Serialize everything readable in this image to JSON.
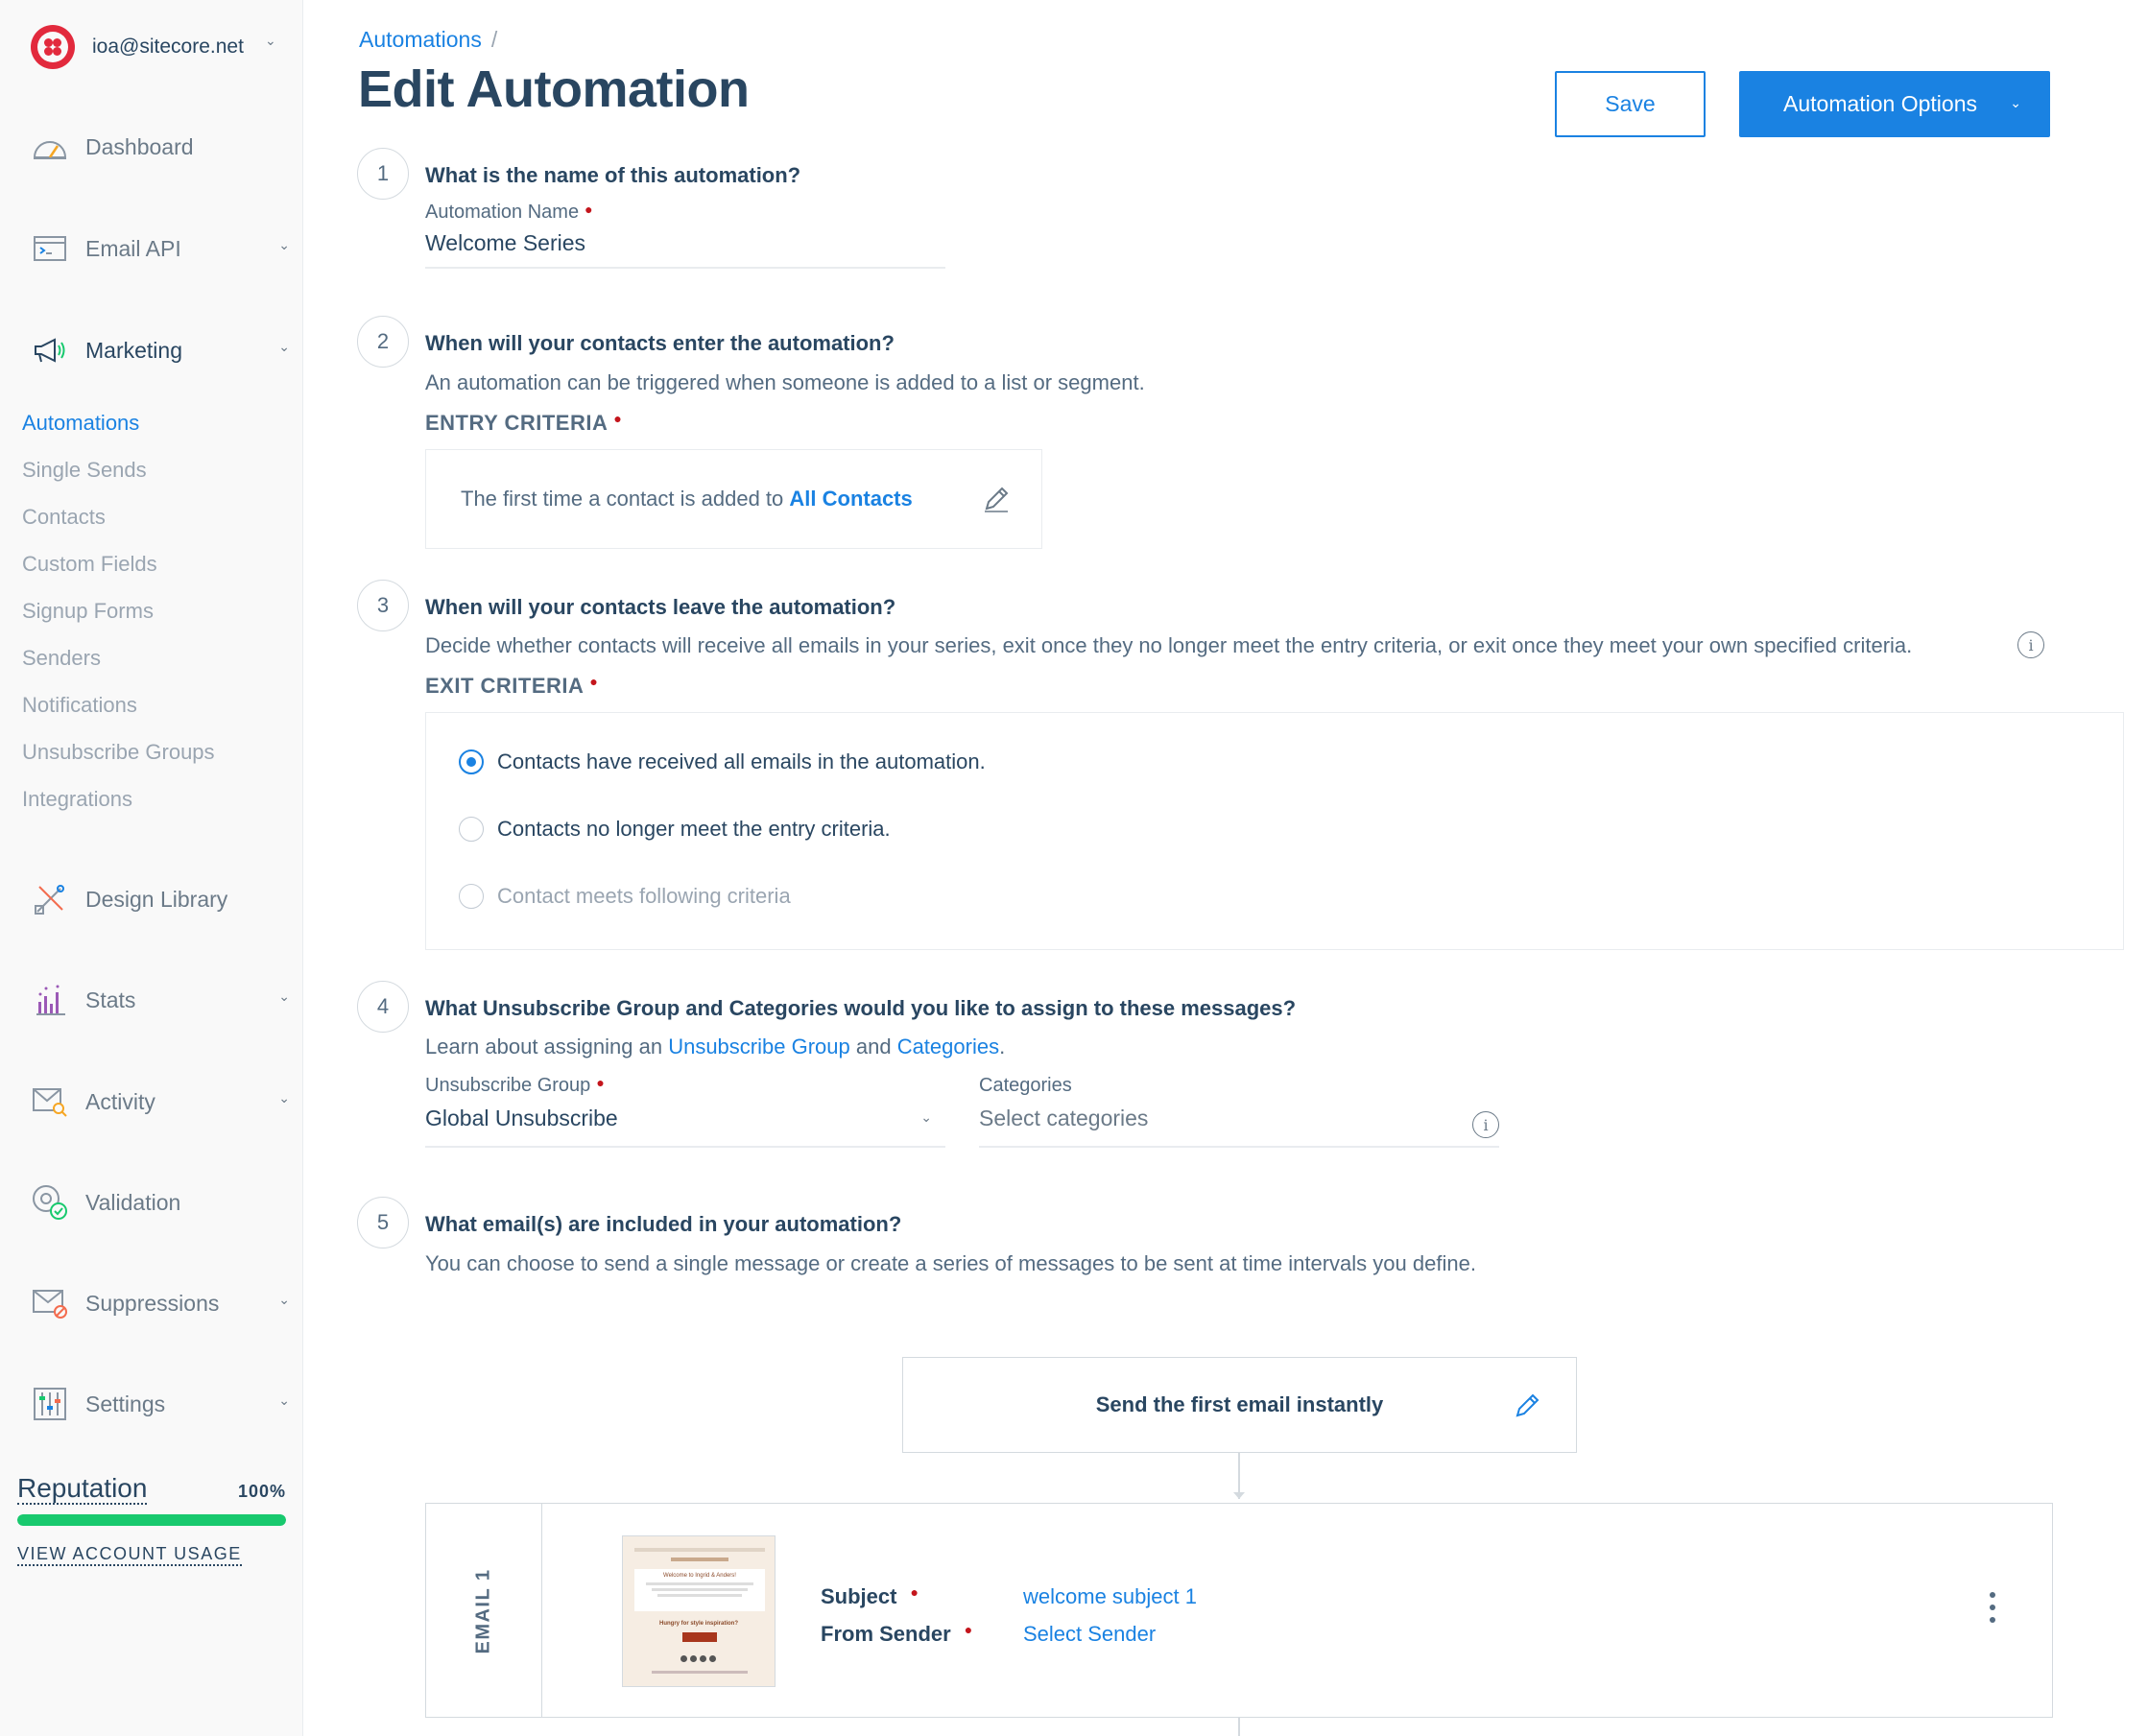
{
  "sidebar": {
    "account_email": "ioa@sitecore.net",
    "nav": [
      {
        "label": "Dashboard",
        "icon": "dashboard-icon"
      },
      {
        "label": "Email API",
        "icon": "terminal-icon"
      },
      {
        "label": "Marketing",
        "icon": "megaphone-icon"
      },
      {
        "label": "Design Library",
        "icon": "design-tools-icon"
      },
      {
        "label": "Stats",
        "icon": "bar-chart-icon"
      },
      {
        "label": "Activity",
        "icon": "activity-mail-search-icon"
      },
      {
        "label": "Validation",
        "icon": "at-check-icon"
      },
      {
        "label": "Suppressions",
        "icon": "mail-block-icon"
      },
      {
        "label": "Settings",
        "icon": "sliders-icon"
      }
    ],
    "marketing_sub": [
      "Automations",
      "Single Sends",
      "Contacts",
      "Custom Fields",
      "Signup Forms",
      "Senders",
      "Notifications",
      "Unsubscribe Groups",
      "Integrations"
    ],
    "reputation": {
      "label": "Reputation",
      "percent_text": "100%",
      "percent": 100
    },
    "usage_link": "VIEW ACCOUNT USAGE"
  },
  "header": {
    "breadcrumb": "Automations",
    "breadcrumb_sep": "/",
    "title": "Edit Automation",
    "save_label": "Save",
    "options_label": "Automation Options"
  },
  "steps": {
    "s1": {
      "num": "1",
      "question": "What is the name of this automation?",
      "field_label": "Automation Name",
      "value": "Welcome Series"
    },
    "s2": {
      "num": "2",
      "question": "When will your contacts enter the automation?",
      "description": "An automation can be triggered when someone is added to a list or segment.",
      "criteria_label": "ENTRY CRITERIA",
      "entry_text": "The first time a contact is added to ",
      "entry_link": "All Contacts"
    },
    "s3": {
      "num": "3",
      "question": "When will your contacts leave the automation?",
      "description": "Decide whether contacts will receive all emails in your series, exit once they no longer meet the entry criteria, or exit once they meet your own specified criteria.",
      "criteria_label": "EXIT CRITERIA",
      "options": [
        "Contacts have received all emails in the automation.",
        "Contacts no longer meet the entry criteria.",
        "Contact meets following criteria"
      ],
      "selected_index": 0
    },
    "s4": {
      "num": "4",
      "question": "What Unsubscribe Group and Categories would you like to assign to these messages?",
      "desc_prefix": "Learn about assigning an ",
      "desc_link1": "Unsubscribe Group",
      "desc_mid": " and ",
      "desc_link2": "Categories",
      "desc_suffix": ".",
      "group_label": "Unsubscribe Group",
      "group_value": "Global Unsubscribe",
      "categories_label": "Categories",
      "categories_placeholder": "Select categories"
    },
    "s5": {
      "num": "5",
      "question": "What email(s) are included in your automation?",
      "description": "You can choose to send a single message or create a series of messages to be sent at time intervals you define.",
      "trigger_label": "Send the first email instantly",
      "email": {
        "side_label": "EMAIL 1",
        "subject_label": "Subject",
        "subject_value": "welcome subject 1",
        "sender_label": "From Sender",
        "sender_value": "Select Sender",
        "thumb_title": "Welcome to Ingrid & Anders!",
        "thumb_cta": "Hungry for style inspiration?"
      }
    }
  },
  "colors": {
    "accent": "#1a82e2",
    "text": "#294661",
    "muted": "#546b81",
    "required": "#c4151c",
    "reputation": "#18c96e",
    "brand": "#e22a3d"
  }
}
